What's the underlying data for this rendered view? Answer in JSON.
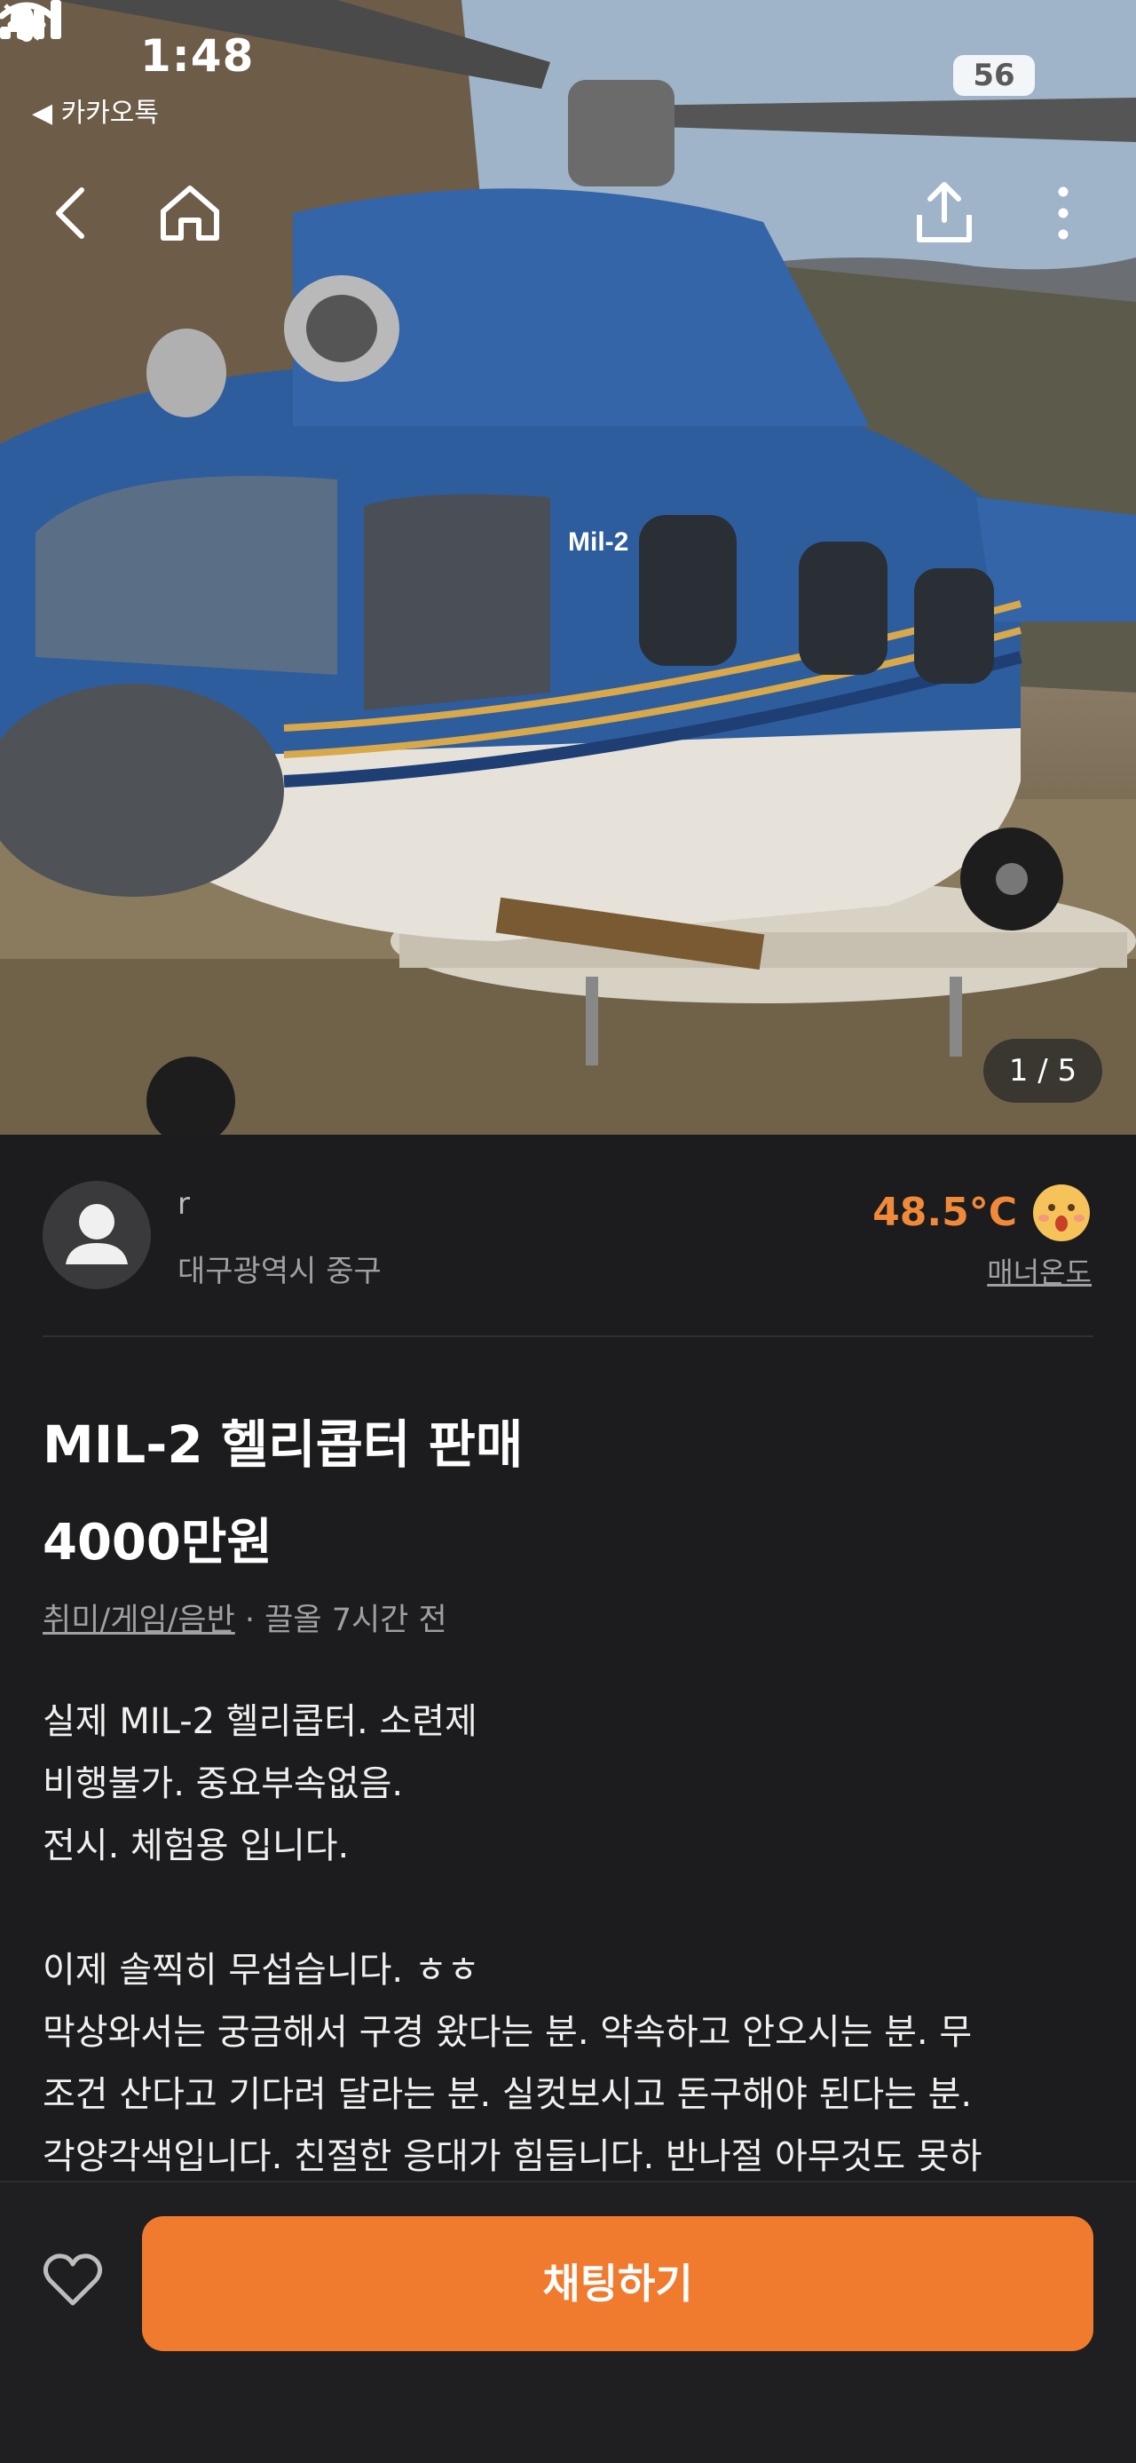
{
  "status_bar": {
    "time": "1:48",
    "back_app": "◀ 카카오톡",
    "battery": "56"
  },
  "image": {
    "subject": "helicopter-photo",
    "label": "Mil-2",
    "counter": "1 / 5"
  },
  "seller": {
    "name": "r",
    "location": "대구광역시 중구",
    "temperature": "48.5°C",
    "temperature_label": "매너온도",
    "accent_color": "#f08a3a"
  },
  "listing": {
    "title": "MIL-2 헬리콥터 판매",
    "price": "4000만원",
    "category": "취미/게임/음반",
    "time_ago": " · 끌올 7시간 전",
    "description": [
      "실제 MIL-2 헬리콥터. 소련제",
      "비행불가. 중요부속없음.",
      "전시. 체험용 입니다.",
      "",
      "이제 솔찍히 무섭습니다. ㅎㅎ",
      "막상와서는 궁금해서 구경 왔다는 분. 약속하고 안오시는 분. 무",
      "조건 산다고 기다려 달라는 분. 실컷보시고 돈구해야 된다는 분.",
      "각양각색입니다. 친절한 응대가 힘듭니다. 반나절 아무것도 못하"
    ]
  },
  "bottom_bar": {
    "chat_label": "채팅하기",
    "button_color": "#f07a2e"
  }
}
